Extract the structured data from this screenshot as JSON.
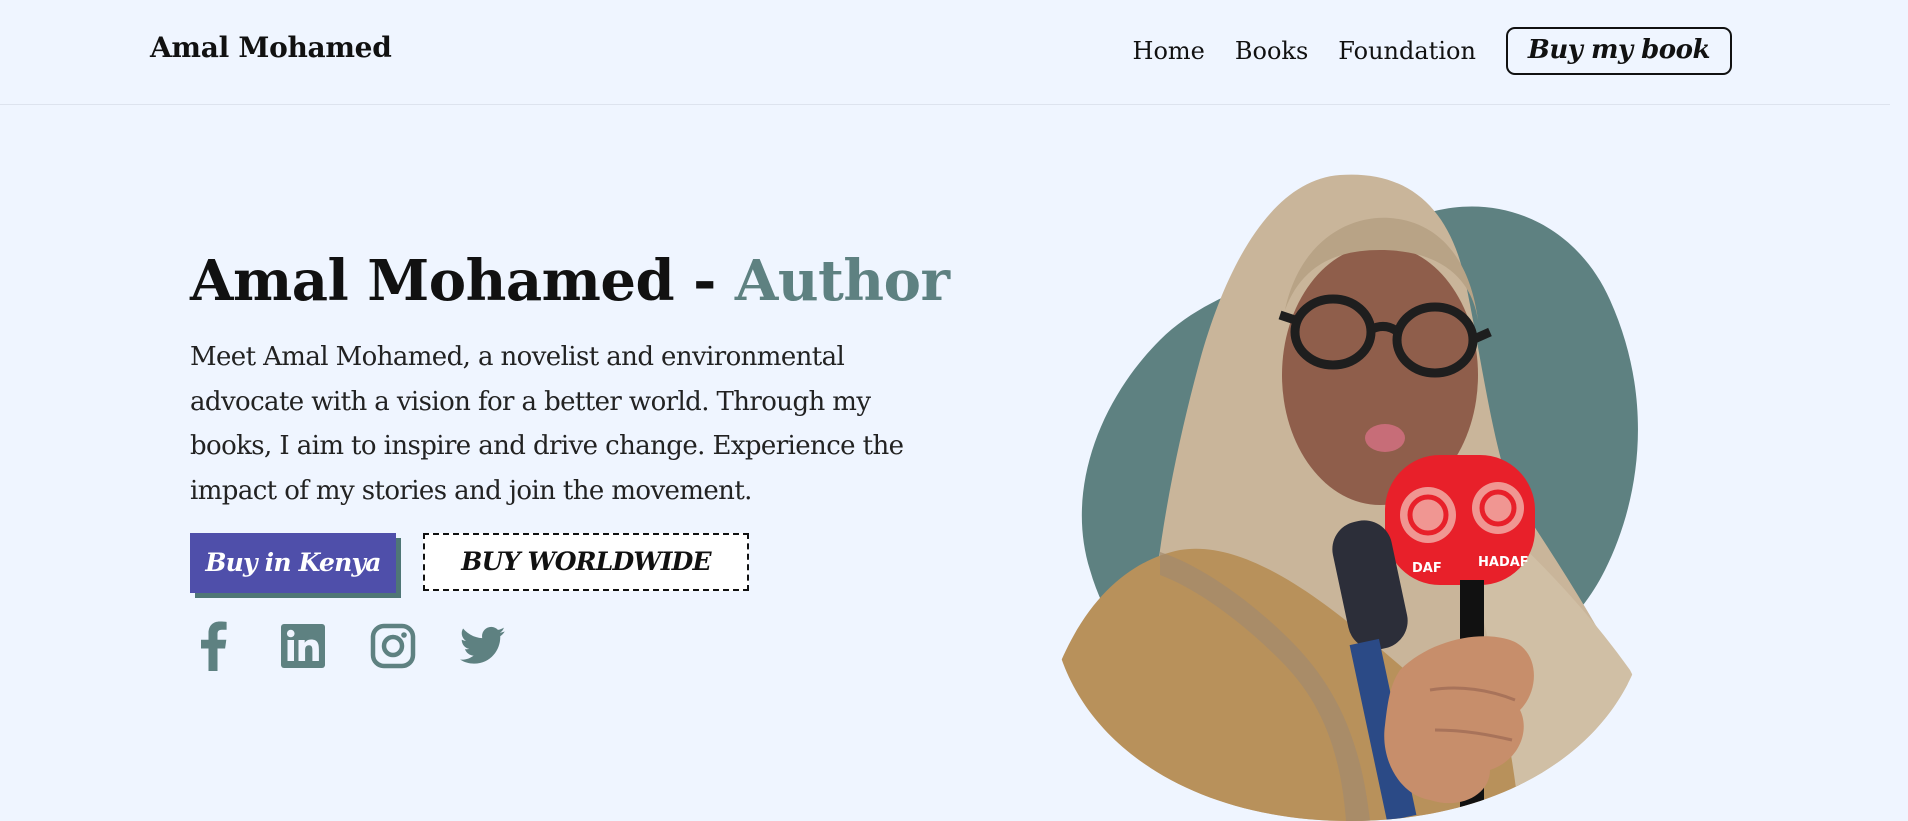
{
  "header": {
    "brand": "Amal Mohamed",
    "nav": {
      "home": "Home",
      "books": "Books",
      "foundation": "Foundation",
      "cta": "Buy my book"
    }
  },
  "hero": {
    "title_main": "Amal Mohamed -",
    "title_accent": "Author",
    "description": "Meet Amal Mohamed, a novelist and environmental advocate with a vision for a better world. Through my books, I aim to inspire and drive change. Experience the impact of my stories and join the movement.",
    "buttons": {
      "kenya": "Buy in Kenya",
      "worldwide": "BUY WORLDWIDE"
    },
    "socials": [
      "facebook-icon",
      "linkedin-icon",
      "instagram-icon",
      "twitter-icon"
    ],
    "portrait": {
      "mic_label_left": "DAF",
      "mic_label_right": "HADAF"
    }
  },
  "colors": {
    "background": "#eff5ff",
    "accent_teal": "#5e8181",
    "button_purple": "#4f4faa",
    "text_dark": "#111111"
  }
}
